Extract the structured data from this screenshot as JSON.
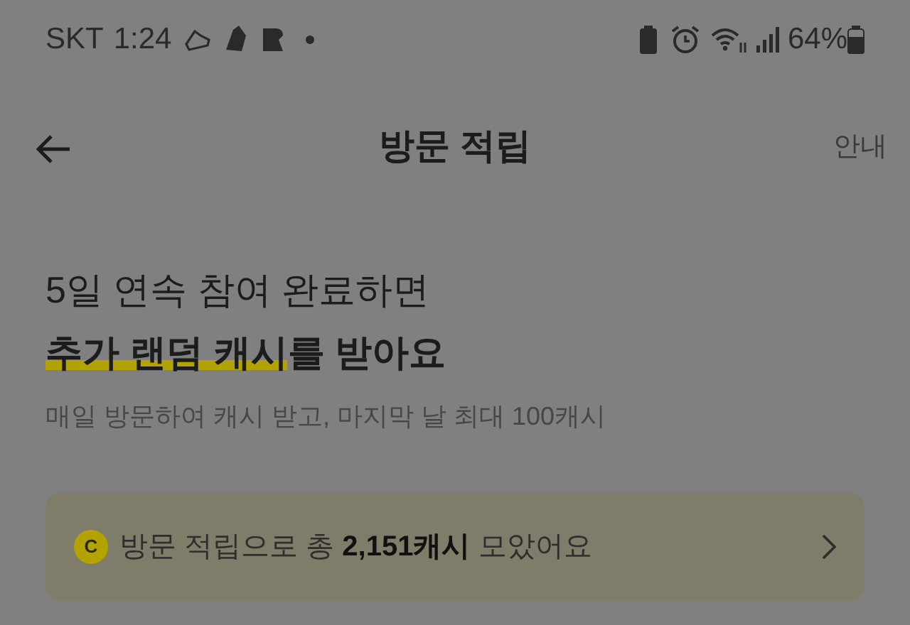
{
  "status_bar": {
    "carrier": "SKT",
    "time": "1:24",
    "battery": "64%"
  },
  "header": {
    "title": "방문 적립",
    "action": "안내"
  },
  "headline": {
    "line1": "5일 연속 참여 완료하면",
    "line2_highlight": "추가 랜덤 캐시",
    "line2_rest": "를 받아요"
  },
  "subtitle": "매일 방문하여 캐시 받고, 마지막 날 최대 100캐시",
  "summary_card": {
    "coin": "C",
    "text": "방문 적립으로 총 **2,151캐시** 모았어요"
  }
}
